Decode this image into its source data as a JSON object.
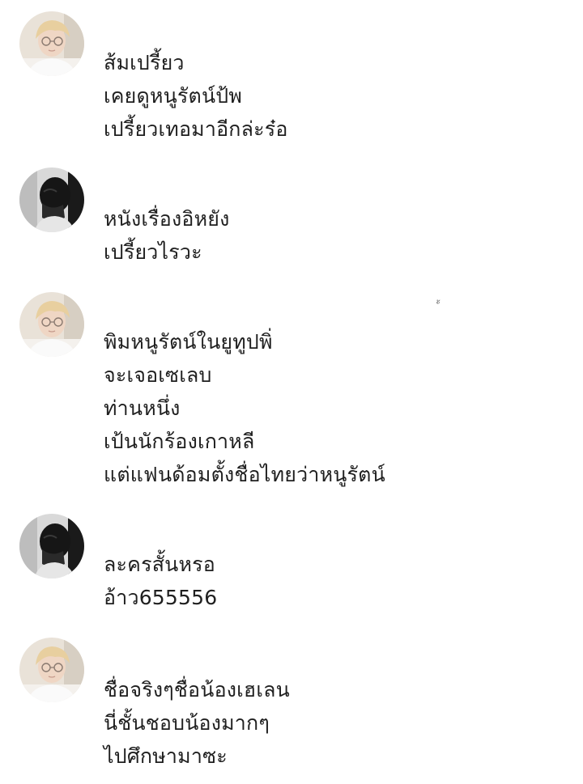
{
  "chat": {
    "messages": [
      {
        "avatar": "light-haired-person-with-glasses",
        "lines": [
          "ส้มเปรี้ยว",
          "เคยดูหนูรัตน์ป้พ",
          "เปรี้ยวเทอมาอีกล่ะร๋อ"
        ]
      },
      {
        "avatar": "person-covering-face-bw",
        "lines": [
          "หนังเรื่องอิหยัง",
          "เปรี้ยวไรวะ"
        ]
      },
      {
        "avatar": "light-haired-person-with-glasses",
        "lines": [
          "พิมหนูรัตน์ในยูทูปพิ่",
          "จะเจอเซเลบ",
          "ท่านหนึ่ง",
          "เป้นนักร้องเกาหลี",
          "แต่แฟนด้อมตั้งชื่อไทยว่าหนูรัตน์"
        ]
      },
      {
        "avatar": "person-covering-face-bw",
        "lines": [
          "ละครสั้นหรอ",
          "อ้าว655556"
        ]
      },
      {
        "avatar": "light-haired-person-with-glasses",
        "lines": [
          "ชื่อจริงๆชื่อน้องเฮเลน",
          "นี่ชั้นชอบน้องมากๆ",
          "ไปศึกษามาซะ"
        ]
      }
    ],
    "stray_mark": "ั้"
  }
}
